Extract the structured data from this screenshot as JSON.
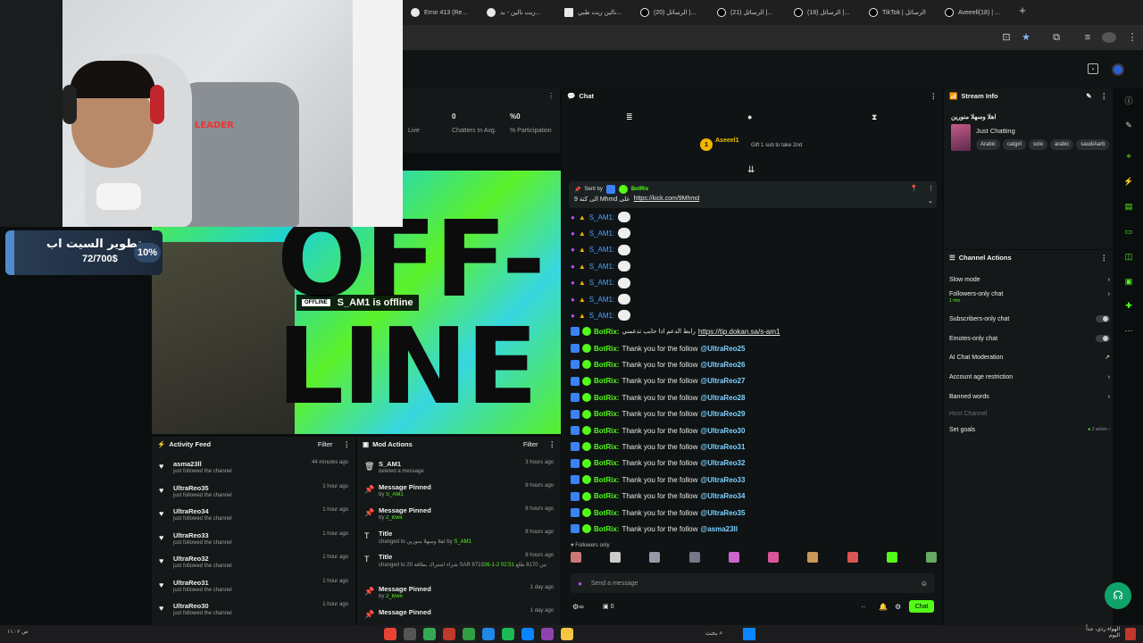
{
  "browser": {
    "tabs": [
      {
        "label": "Error 413 (Re..."
      },
      {
        "label": "زيت نالين - بد..."
      },
      {
        "label": "نالين زيت طبي..."
      },
      {
        "label": "(20) الرسائل |..."
      },
      {
        "label": "(21) الرسائل |..."
      },
      {
        "label": "(18) الرسائل |..."
      },
      {
        "label": "TikTok | الرسائل"
      },
      {
        "label": "Aveeell(18) | ..."
      }
    ]
  },
  "overlay": {
    "goal_title": "تطوير السيت اب",
    "goal_progress": "72/700$",
    "goal_percent": "10%",
    "camera_brand": "LEADER"
  },
  "preview": {
    "offline_badge": "OFFLINE",
    "offline_text": "S_AM1 is offline",
    "bg_word_1": "OFF-",
    "bg_word_2": "LINE"
  },
  "stats": {
    "live_label": "Live",
    "chatters_value": "0",
    "chatters_label": "Chatters In Avg.",
    "participation_value": "%0",
    "participation_label": "% Participation"
  },
  "activity_feed": {
    "title": "Activity Feed",
    "filter": "Filter",
    "items": [
      {
        "name": "asma23ll",
        "sub": "just followed the channel",
        "time": "44 minutes ago"
      },
      {
        "name": "UltraReo35",
        "sub": "just followed the channel",
        "time": "1 hour ago"
      },
      {
        "name": "UltraReo34",
        "sub": "just followed the channel",
        "time": "1 hour ago"
      },
      {
        "name": "UltraReo33",
        "sub": "just followed the channel",
        "time": "1 hour ago"
      },
      {
        "name": "UltraReo32",
        "sub": "just followed the channel",
        "time": "1 hour ago"
      },
      {
        "name": "UltraReo31",
        "sub": "just followed the channel",
        "time": "1 hour ago"
      },
      {
        "name": "UltraReo30",
        "sub": "just followed the channel",
        "time": "1 hour ago"
      }
    ]
  },
  "mod_actions": {
    "title": "Mod Actions",
    "filter": "Filter",
    "items": [
      {
        "name": "S_AM1",
        "sub": "deleted a message",
        "by": "",
        "time": "3 hours ago"
      },
      {
        "name": "Message Pinned",
        "sub": "by",
        "by": "S_AM1",
        "time": "8 hours ago"
      },
      {
        "name": "Message Pinned",
        "sub": "by",
        "by": "2_lowx",
        "time": "8 hours ago"
      },
      {
        "name": "Title",
        "sub": "changed to اهلا وسهلا منورين by",
        "by": "S_AM1",
        "time": "8 hours ago"
      },
      {
        "name": "Title",
        "sub": "changed to شراء اشتراك بطاقة 20 SAR 8719بحرب قل بي من 8170 طلع",
        "by": "02:51 2-1-26 by S_AM1",
        "time": "8 hours ago"
      },
      {
        "name": "Message Pinned",
        "sub": "by",
        "by": "2_lowx",
        "time": "1 day ago"
      },
      {
        "name": "Message Pinned",
        "sub": "",
        "by": "",
        "time": "1 day ago"
      }
    ]
  },
  "chat": {
    "title": "Chat",
    "gift_user": "Aseeel1",
    "gift_count": "1",
    "gift_text": "Gift 1 sub to take 2nd",
    "pinned_sent_by": "Sent by",
    "pinned_user": "BotRix",
    "pinned_text": "9 الى كتة Mhmd على",
    "pinned_link": "https://kick.com/9Mhmd",
    "emote_user": "S_AM1:",
    "emote_rows": 7,
    "tip_user": "BotRix:",
    "tip_text": "رابط الدعم اذا حابب تدعمني",
    "tip_link": "https://tip.dokan.sa/s-am1",
    "follow_text": "Thank you for the follow",
    "follow_users": [
      "@UltraReo25",
      "@UltraReo26",
      "@UltraReo27",
      "@UltraReo28",
      "@UltraReo29",
      "@UltraReo30",
      "@UltraReo31",
      "@UltraReo32",
      "@UltraReo33",
      "@UltraReo34",
      "@UltraReo35",
      "@asma23ll"
    ],
    "followers_only": "Followers only",
    "input_placeholder": "Send a message",
    "counter": "0",
    "send_label": "Chat"
  },
  "stream_info": {
    "title": "Stream Info",
    "stream_title": "اهلا وسهلا منورين",
    "category": "Just Chatting",
    "tags": [
      "Arabic",
      "catgirl",
      "solo",
      "arabic",
      "saudiAarb"
    ]
  },
  "channel_actions": {
    "title": "Channel Actions",
    "slow_mode": "Slow mode",
    "followers_only": "Followers-only chat",
    "followers_sub": "1 min",
    "subscribers_only": "Subscribers-only chat",
    "emotes_only": "Emotes-only chat",
    "ai_moderation": "AI Chat Moderation",
    "age_restriction": "Account age restriction",
    "banned_words": "Banned words",
    "host_channel": "Host Channel",
    "set_goals": "Set goals",
    "goals_active": "2 active"
  },
  "taskbar": {
    "search_text": "بحث",
    "weather": "الهواء رذي، جداً",
    "weather_sub": "اليوم"
  },
  "colors": {
    "accent": "#53fc18",
    "link_blue": "#4ea1ff"
  }
}
